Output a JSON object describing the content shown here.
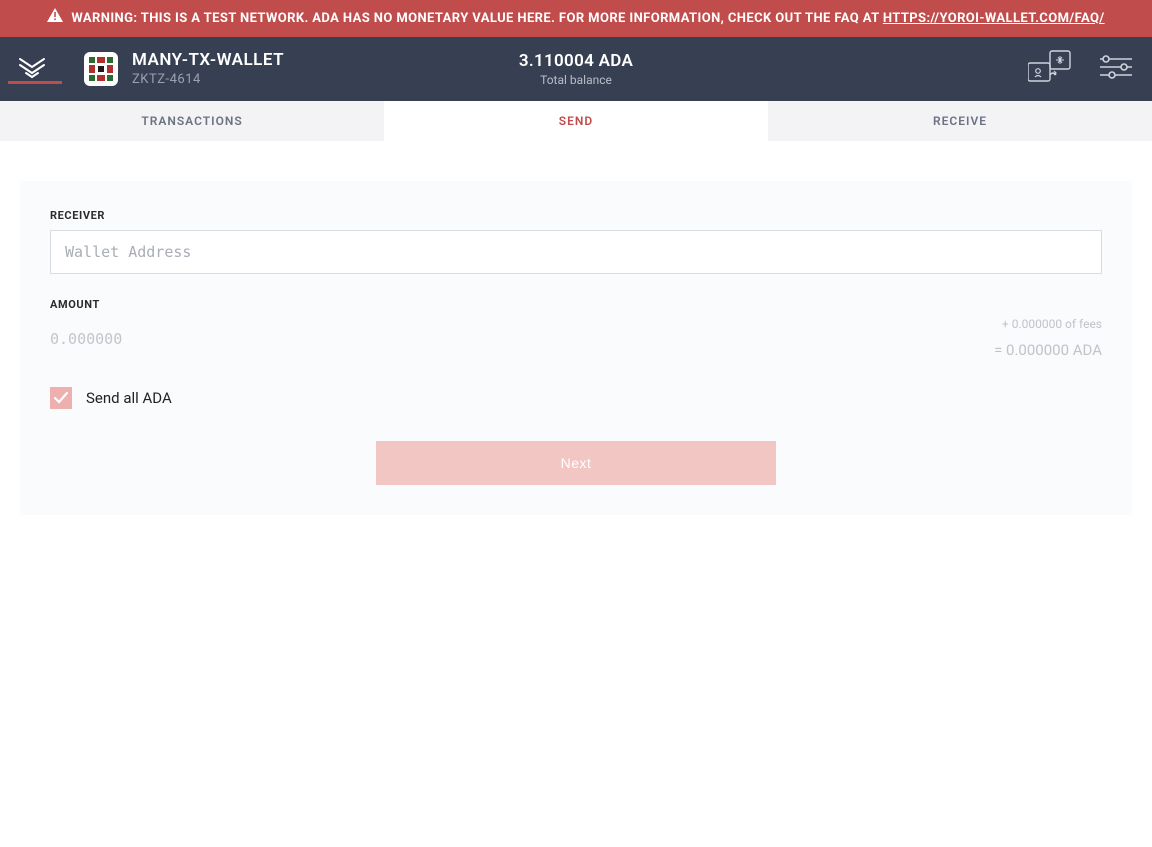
{
  "warning": {
    "text": "WARNING: THIS IS A TEST NETWORK. ADA HAS NO MONETARY VALUE HERE. FOR MORE INFORMATION, CHECK OUT THE FAQ AT ",
    "link_text": "HTTPS://YOROI-WALLET.COM/FAQ/"
  },
  "header": {
    "wallet_name": "MANY-TX-WALLET",
    "wallet_code": "ZKTZ-4614",
    "balance_value": "3.110004 ADA",
    "balance_label": "Total balance"
  },
  "tabs": {
    "items": [
      "TRANSACTIONS",
      "SEND",
      "RECEIVE"
    ],
    "active_index": 1
  },
  "form": {
    "receiver_label": "RECEIVER",
    "receiver_placeholder": "Wallet Address",
    "receiver_value": "",
    "amount_label": "AMOUNT",
    "amount_placeholder": "0.000000",
    "amount_value": "",
    "fees_text": "+ 0.000000 of fees",
    "equals_text": "= 0.000000 ADA",
    "send_all_label": "Send all ADA",
    "send_all_checked": true,
    "next_label": "Next"
  },
  "colors": {
    "accent": "#c14c4c",
    "header_bg": "#373f52"
  }
}
